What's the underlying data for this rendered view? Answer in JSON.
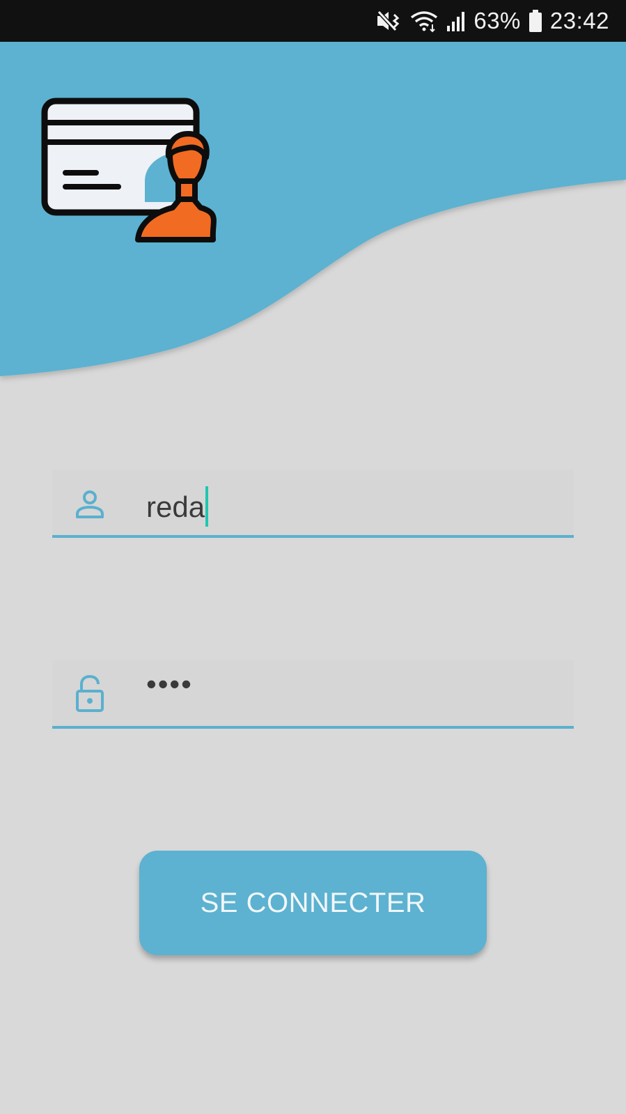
{
  "status_bar": {
    "battery_percent": "63%",
    "time": "23:42",
    "icons": [
      "vibrate-mute-icon",
      "wifi-icon",
      "signal-icon",
      "battery-icon"
    ]
  },
  "theme": {
    "accent": "#5cb2d0",
    "background": "#d9d9d9",
    "cursor": "#1fc7b0",
    "avatar": "#f26b22"
  },
  "logo": {
    "icon": "id-card-user-icon"
  },
  "username_field": {
    "icon": "person-icon",
    "value": "reda"
  },
  "password_field": {
    "icon": "lock-icon",
    "masked_value": "••••"
  },
  "login_button": {
    "label": "SE CONNECTER"
  }
}
